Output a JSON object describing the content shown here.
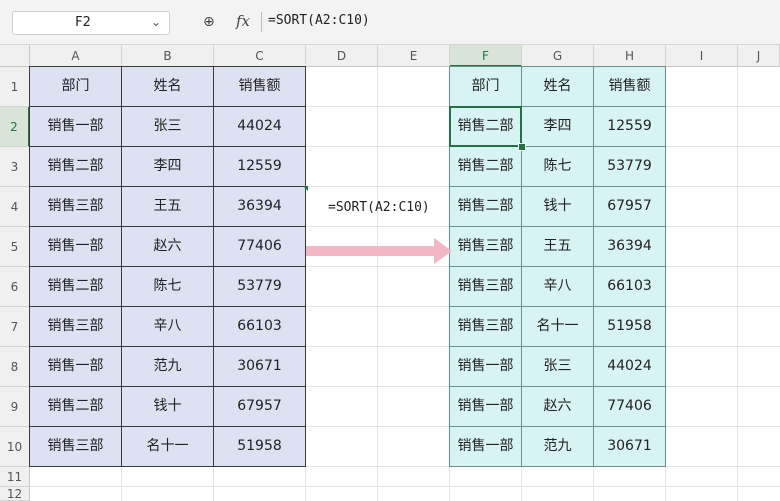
{
  "formula_bar": {
    "name_box": "F2",
    "formula": "=SORT(A2:C10)",
    "fx_label": "fx"
  },
  "columns": [
    "A",
    "B",
    "C",
    "D",
    "E",
    "F",
    "G",
    "H",
    "I",
    "J"
  ],
  "rows": [
    "1",
    "2",
    "3",
    "4",
    "5",
    "6",
    "7",
    "8",
    "9",
    "10",
    "11",
    "12"
  ],
  "source_table": {
    "headers": [
      "部门",
      "姓名",
      "销售额"
    ],
    "rows": [
      [
        "销售一部",
        "张三",
        "44024"
      ],
      [
        "销售二部",
        "李四",
        "12559"
      ],
      [
        "销售三部",
        "王五",
        "36394"
      ],
      [
        "销售一部",
        "赵六",
        "77406"
      ],
      [
        "销售二部",
        "陈七",
        "53779"
      ],
      [
        "销售三部",
        "辛八",
        "66103"
      ],
      [
        "销售一部",
        "范九",
        "30671"
      ],
      [
        "销售二部",
        "钱十",
        "67957"
      ],
      [
        "销售三部",
        "名十一",
        "51958"
      ]
    ]
  },
  "sorted_table": {
    "headers": [
      "部门",
      "姓名",
      "销售额"
    ],
    "rows": [
      [
        "销售二部",
        "李四",
        "12559"
      ],
      [
        "销售二部",
        "陈七",
        "53779"
      ],
      [
        "销售二部",
        "钱十",
        "67957"
      ],
      [
        "销售三部",
        "王五",
        "36394"
      ],
      [
        "销售三部",
        "辛八",
        "66103"
      ],
      [
        "销售三部",
        "名十一",
        "51958"
      ],
      [
        "销售一部",
        "张三",
        "44024"
      ],
      [
        "销售一部",
        "赵六",
        "77406"
      ],
      [
        "销售一部",
        "范九",
        "30671"
      ]
    ]
  },
  "annotation": "=SORT(A2:C10)",
  "colors": {
    "source_fill": "#dde2f3",
    "sorted_fill": "#d8f3f3",
    "arrow": "#f2b6c4",
    "selection": "#217346"
  }
}
